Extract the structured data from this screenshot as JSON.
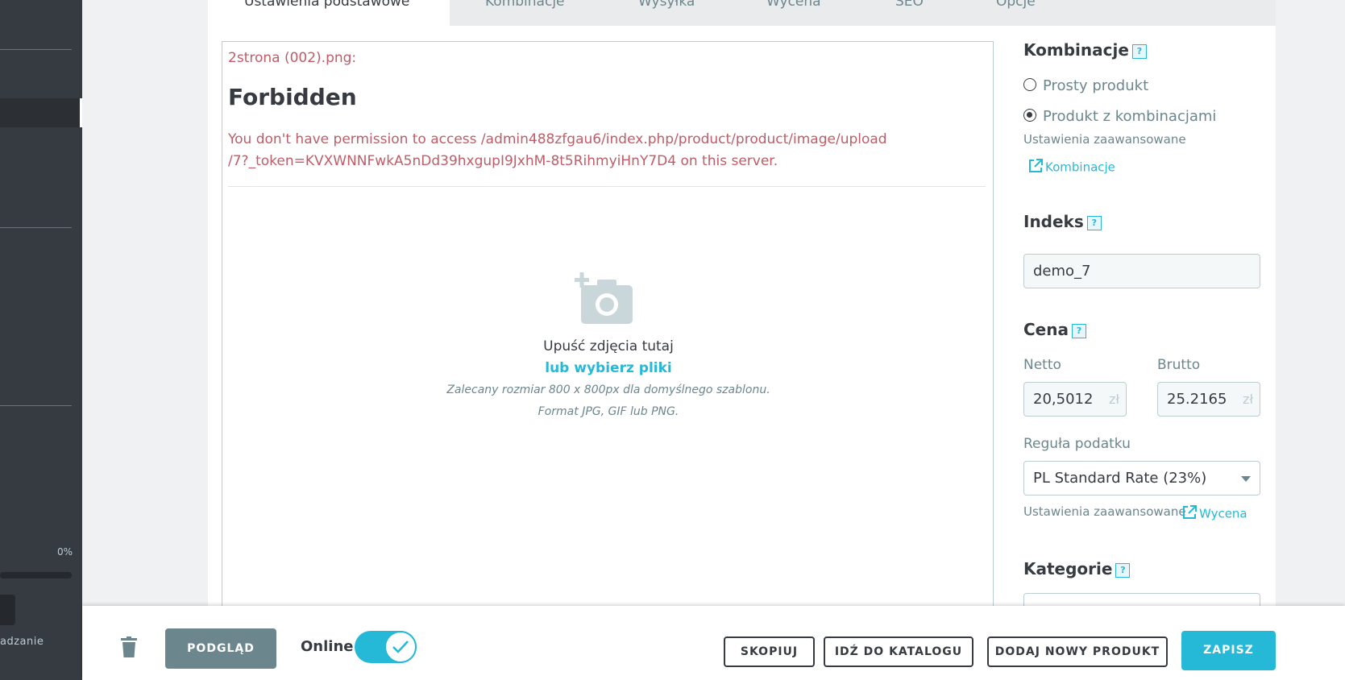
{
  "tabs": {
    "active": "Ustawienia podstawowe",
    "items": [
      "Kombinacje",
      "Wysyłka",
      "Wycena",
      "SEO",
      "Opcje"
    ]
  },
  "sidebar": {
    "progress_text": "0%",
    "progress_value": 0,
    "bottom_text": "adzanie"
  },
  "upload": {
    "error_filename": "2strona (002).png:",
    "error_title": "Forbidden",
    "error_message": "You don't have permission to access /admin488zfgau6/index.php/product/product/image/upload /7?_token=KVXWNNFwkA5nDd39hxgupI9JxhM-8t5RihmyiHnY7D4 on this server.",
    "drop_text": "Upuść zdjęcia tutaj",
    "choose_files": "lub wybierz pliki",
    "hint_size": "Zalecany rozmiar 800 x 800px dla domyślnego szablonu.",
    "hint_format": "Format JPG, GIF lub PNG.",
    "icon": "add-photo-icon"
  },
  "combinations": {
    "title": "Kombinacje",
    "help": "?",
    "option_simple": "Prosty produkt",
    "option_combinations": "Produkt z kombinacjami",
    "selected": "Produkt z kombinacjami",
    "advanced_label": "Ustawienia zaawansowane",
    "link": "Kombinacje"
  },
  "index": {
    "title": "Indeks",
    "help": "?",
    "value": "demo_7"
  },
  "price": {
    "title": "Cena",
    "help": "?",
    "net_label": "Netto",
    "net_value": "20,5012",
    "gross_label": "Brutto",
    "gross_value": "25.2165",
    "currency": "zł",
    "tax_label": "Reguła podatku",
    "tax_value": "PL Standard Rate (23%)",
    "advanced_label": "Ustawienia zaawansowane",
    "link": "Wycena"
  },
  "categories": {
    "title": "Kategorie",
    "help": "?"
  },
  "footer": {
    "preview": "PODGLĄD",
    "online_label": "Online",
    "online_state": true,
    "duplicate": "SKOPIUJ",
    "go_to_catalog": "IDŹ DO KATALOGU",
    "add_new_product": "DODAJ NOWY PRODUKT",
    "save": "ZAPISZ"
  },
  "colors": {
    "accent": "#25b9d7",
    "error": "#c05c67",
    "sidebar": "#363a41",
    "muted": "#6c868e"
  }
}
